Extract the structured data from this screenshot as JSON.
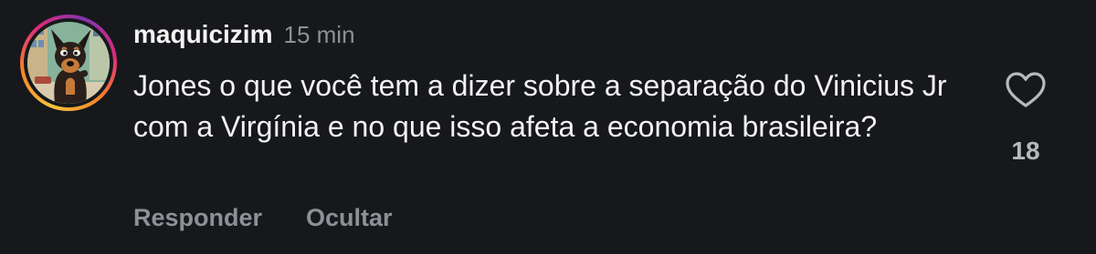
{
  "comment": {
    "username": "maquicizim",
    "timestamp": "15 min",
    "text": "Jones o que você tem a dizer sobre a separação do Vinicius Jr com a Virgínia e no que isso afeta a economia brasileira?",
    "actions": {
      "reply_label": "Responder",
      "hide_label": "Ocultar"
    },
    "likes": {
      "count": "18",
      "icon": "heart-icon"
    },
    "avatar": {
      "icon": "cartoon-dog-avatar",
      "story_ring_colors": [
        "#f9c23c",
        "#f58529",
        "#dd2a7b",
        "#8134af"
      ]
    }
  },
  "colors": {
    "background": "#16181c",
    "text_primary": "#f2f2f2",
    "text_secondary": "#8e9096"
  }
}
